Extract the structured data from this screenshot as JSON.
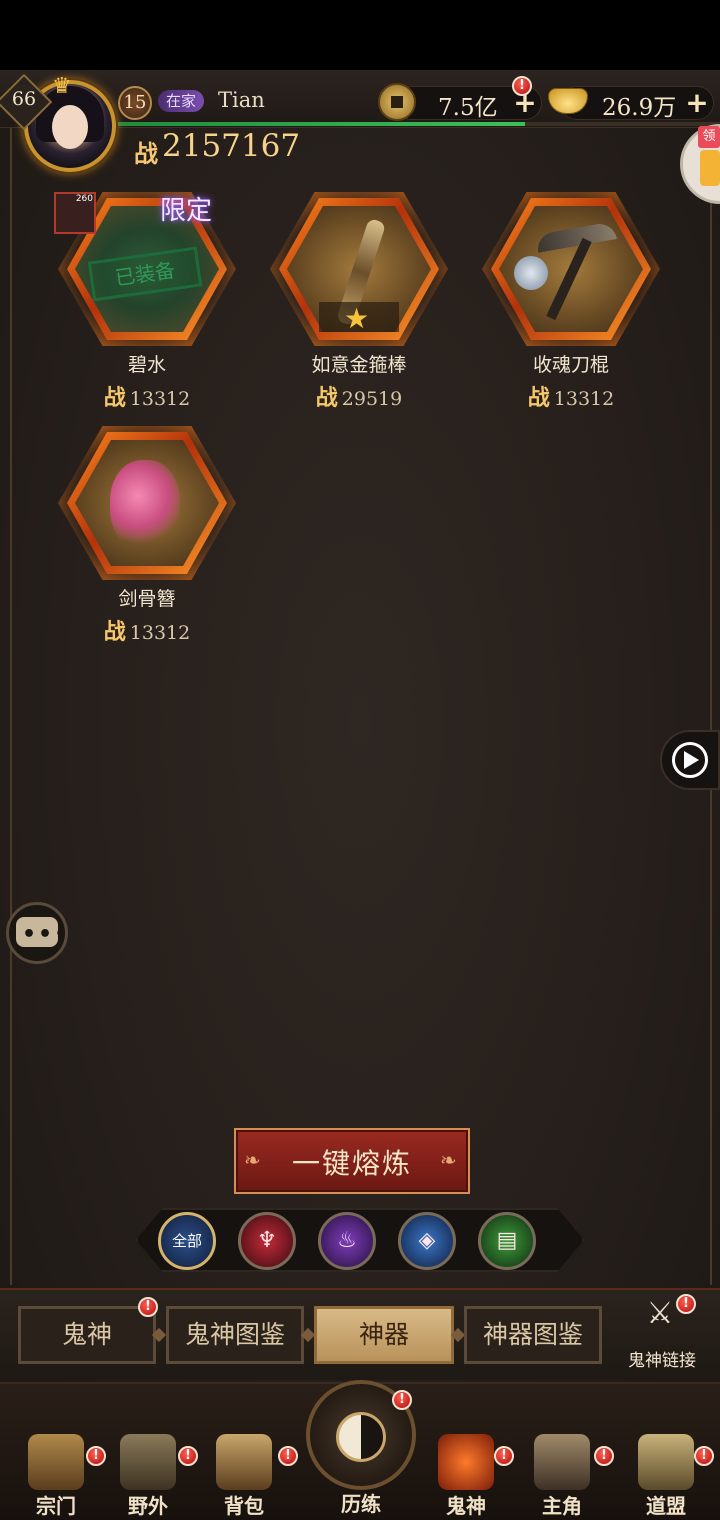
{
  "header": {
    "level": "66",
    "vip_level": "15",
    "tag": "在家",
    "player_name": "Tian",
    "power_mark": "战",
    "power": "2157167",
    "exp_progress": 0.68,
    "currency": {
      "coins": "7.5亿",
      "ingots": "26.9万",
      "plus": "+"
    },
    "side_gift_tag": "领"
  },
  "items": [
    {
      "name": "碧水",
      "power": "13312",
      "limited_tag": "限定",
      "stamp": "已装备",
      "portrait_level": "260"
    },
    {
      "name": "如意金箍棒",
      "power": "29519",
      "star": "★"
    },
    {
      "name": "收魂刀棍",
      "power": "13312"
    },
    {
      "name": "剑骨簪",
      "power": "13312"
    }
  ],
  "power_label": "战",
  "smelt_button": "一键熔炼",
  "filters": {
    "all_label": "全部",
    "icons": [
      "filter-all-icon",
      "filter-red-icon",
      "filter-purple-icon",
      "filter-blue-icon",
      "filter-green-icon"
    ]
  },
  "tabs": [
    {
      "label": "鬼神",
      "active": false
    },
    {
      "label": "鬼神图鉴",
      "active": false
    },
    {
      "label": "神器",
      "active": true
    },
    {
      "label": "神器图鉴",
      "active": false
    }
  ],
  "link": {
    "label": "鬼神链接"
  },
  "bottom_nav": [
    {
      "label": "宗门"
    },
    {
      "label": "野外"
    },
    {
      "label": "背包"
    },
    {
      "label": "历练"
    },
    {
      "label": "鬼神",
      "active": true
    },
    {
      "label": "主角"
    },
    {
      "label": "道盟"
    }
  ],
  "badge": "!",
  "colors": {
    "accent_gold": "#f6d28a",
    "badge_red": "#d61818",
    "active_tab": "#d9ba86",
    "smelt_red": "#9a2a22"
  }
}
